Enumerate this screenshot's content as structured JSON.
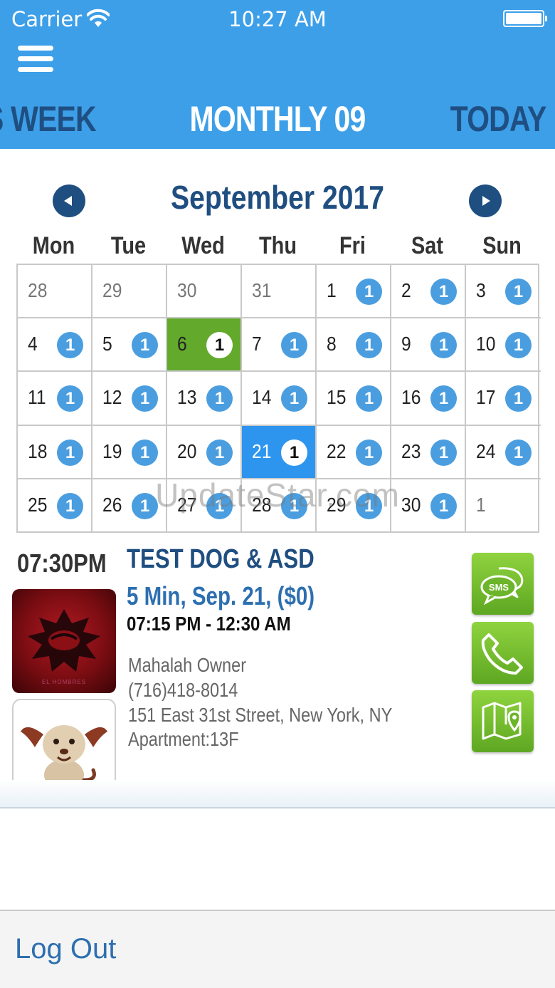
{
  "status_bar": {
    "carrier": "Carrier",
    "time": "10:27 AM"
  },
  "nav": {
    "tabs": [
      "S WEEK",
      "MONTHLY 09",
      "TODAY"
    ]
  },
  "calendar": {
    "month_title": "September 2017",
    "weekdays": [
      "Mon",
      "Tue",
      "Wed",
      "Thu",
      "Fri",
      "Sat",
      "Sun"
    ],
    "weeks": [
      [
        {
          "day": "28",
          "count": "",
          "state": "muted"
        },
        {
          "day": "29",
          "count": "",
          "state": "muted"
        },
        {
          "day": "30",
          "count": "",
          "state": "muted"
        },
        {
          "day": "31",
          "count": "",
          "state": "muted"
        },
        {
          "day": "1",
          "count": "1",
          "state": ""
        },
        {
          "day": "2",
          "count": "1",
          "state": ""
        },
        {
          "day": "3",
          "count": "1",
          "state": ""
        }
      ],
      [
        {
          "day": "4",
          "count": "1",
          "state": ""
        },
        {
          "day": "5",
          "count": "1",
          "state": ""
        },
        {
          "day": "6",
          "count": "1",
          "state": "today"
        },
        {
          "day": "7",
          "count": "1",
          "state": ""
        },
        {
          "day": "8",
          "count": "1",
          "state": ""
        },
        {
          "day": "9",
          "count": "1",
          "state": ""
        },
        {
          "day": "10",
          "count": "1",
          "state": ""
        }
      ],
      [
        {
          "day": "11",
          "count": "1",
          "state": ""
        },
        {
          "day": "12",
          "count": "1",
          "state": ""
        },
        {
          "day": "13",
          "count": "1",
          "state": ""
        },
        {
          "day": "14",
          "count": "1",
          "state": ""
        },
        {
          "day": "15",
          "count": "1",
          "state": ""
        },
        {
          "day": "16",
          "count": "1",
          "state": ""
        },
        {
          "day": "17",
          "count": "1",
          "state": ""
        }
      ],
      [
        {
          "day": "18",
          "count": "1",
          "state": ""
        },
        {
          "day": "19",
          "count": "1",
          "state": ""
        },
        {
          "day": "20",
          "count": "1",
          "state": ""
        },
        {
          "day": "21",
          "count": "1",
          "state": "selected"
        },
        {
          "day": "22",
          "count": "1",
          "state": ""
        },
        {
          "day": "23",
          "count": "1",
          "state": ""
        },
        {
          "day": "24",
          "count": "1",
          "state": ""
        }
      ],
      [
        {
          "day": "25",
          "count": "1",
          "state": ""
        },
        {
          "day": "26",
          "count": "1",
          "state": ""
        },
        {
          "day": "27",
          "count": "1",
          "state": ""
        },
        {
          "day": "28",
          "count": "1",
          "state": ""
        },
        {
          "day": "29",
          "count": "1",
          "state": ""
        },
        {
          "day": "30",
          "count": "1",
          "state": ""
        },
        {
          "day": "1",
          "count": "",
          "state": "muted"
        }
      ]
    ]
  },
  "watermark": "UpdateStar.com",
  "appointment": {
    "time": "07:30PM",
    "title": "TEST DOG & ASD",
    "summary": "5 Min, Sep. 21, ($0)",
    "hours": "07:15 PM - 12:30 AM",
    "owner": "Mahalah Owner",
    "phone": "(716)418-8014",
    "address": "151 East 31st Street, New York, NY",
    "apartment": "Apartment:13F",
    "poster_caption": "EL HOMBRES",
    "sms_label": "SMS"
  },
  "colors": {
    "header_blue": "#3d9fe8",
    "dark_blue": "#1f4e80",
    "today_green": "#62a92c",
    "selected_blue": "#2e95ef",
    "badge_blue": "#4a9ee0",
    "action_green": "#6cb52a"
  },
  "icons": {
    "menu": "hamburger-menu-icon",
    "prev": "chevron-left-icon",
    "next": "chevron-right-icon",
    "sms": "sms-chat-icon",
    "call": "phone-icon",
    "map": "map-pin-icon"
  },
  "footer": {
    "logout_label": "Log Out"
  }
}
